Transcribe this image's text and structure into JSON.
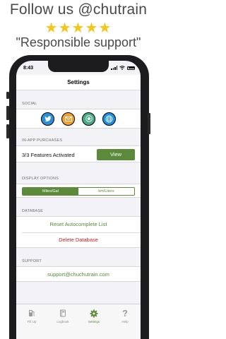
{
  "promo": {
    "title": "Follow us @chutrain",
    "stars": "★★★★★",
    "quote": "\"Responsible support\""
  },
  "status_bar": {
    "time": "8:43"
  },
  "navbar": {
    "title": "Settings"
  },
  "social": {
    "header": "SOCIAL",
    "buttons": [
      {
        "name": "twitter",
        "icon": "twitter-icon",
        "color": "#2b8fd6"
      },
      {
        "name": "email",
        "icon": "mail-icon",
        "color": "#f0a030"
      },
      {
        "name": "rate",
        "icon": "star-icon",
        "color": "#4aaa88"
      },
      {
        "name": "website",
        "icon": "globe-icon",
        "color": "#1d8fe0"
      }
    ]
  },
  "iap": {
    "header": "IN-APP PURCHASES",
    "status": "3/3 Features Activated",
    "view_label": "View"
  },
  "display": {
    "header": "DISPLAY OPTIONS",
    "options": [
      "Miles/Gal",
      "km/Liters"
    ],
    "selected": "Miles/Gal"
  },
  "database": {
    "header": "DATABASE",
    "reset_label": "Reset Autocomplete List",
    "delete_label": "Delete Database"
  },
  "support": {
    "header": "SUPPORT",
    "email": "support@chuchutrain.com"
  },
  "tabs": [
    {
      "label": "Fill Up",
      "icon": "fuel-pump-icon",
      "active": false
    },
    {
      "label": "Logbook",
      "icon": "book-icon",
      "active": false
    },
    {
      "label": "Settings",
      "icon": "gear-icon",
      "active": true
    },
    {
      "label": "Help",
      "icon": "question-icon",
      "active": false
    }
  ],
  "colors": {
    "accent": "#5b8a3a",
    "danger": "#cc1f1f",
    "star": "#f5c518"
  }
}
